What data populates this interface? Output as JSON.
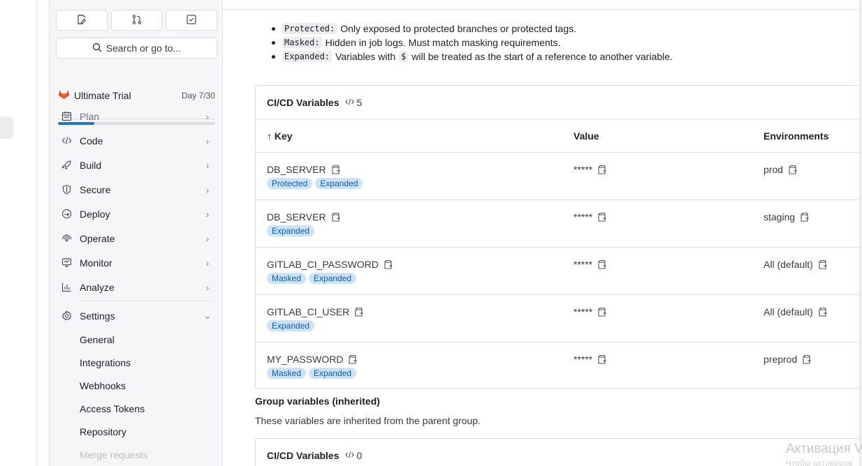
{
  "sidebar": {
    "search_label": "Search or go to...",
    "trial": {
      "label": "Ultimate Trial",
      "day": "Day 7/30",
      "progress": 0.233
    },
    "nav": [
      {
        "label": "Plan",
        "icon": "plan-icon"
      },
      {
        "label": "Code",
        "icon": "code-icon"
      },
      {
        "label": "Build",
        "icon": "rocket-icon"
      },
      {
        "label": "Secure",
        "icon": "shield-icon"
      },
      {
        "label": "Deploy",
        "icon": "deploy-icon"
      },
      {
        "label": "Operate",
        "icon": "cloud-icon"
      },
      {
        "label": "Monitor",
        "icon": "monitor-icon"
      },
      {
        "label": "Analyze",
        "icon": "chart-icon"
      }
    ],
    "settings": {
      "label": "Settings",
      "items": [
        "General",
        "Integrations",
        "Webhooks",
        "Access Tokens",
        "Repository",
        "Merge requests"
      ]
    }
  },
  "info": {
    "protected_code": "Protected:",
    "protected_text": "Only exposed to protected branches or protected tags.",
    "masked_code": "Masked:",
    "masked_text": "Hidden in job logs. Must match masking requirements.",
    "expanded_code": "Expanded:",
    "expanded_text_1": "Variables with",
    "expanded_symbol": "$",
    "expanded_text_2": "will be treated as the start of a reference to another variable."
  },
  "variables_card": {
    "title": "CI/CD Variables",
    "count": "5",
    "headers": {
      "key": "Key",
      "value": "Value",
      "environments": "Environments"
    },
    "sort_indicator": "↑",
    "rows": [
      {
        "key": "DB_SERVER",
        "value": "*****",
        "env": "prod",
        "badges": [
          "Protected",
          "Expanded"
        ]
      },
      {
        "key": "DB_SERVER",
        "value": "*****",
        "env": "staging",
        "badges": [
          "Expanded"
        ]
      },
      {
        "key": "GITLAB_CI_PASSWORD",
        "value": "*****",
        "env": "All (default)",
        "badges": [
          "Masked",
          "Expanded"
        ]
      },
      {
        "key": "GITLAB_CI_USER",
        "value": "*****",
        "env": "All (default)",
        "badges": [
          "Expanded"
        ]
      },
      {
        "key": "MY_PASSWORD",
        "value": "*****",
        "env": "preprod",
        "badges": [
          "Masked",
          "Expanded"
        ]
      }
    ]
  },
  "group_section": {
    "title": "Group variables (inherited)",
    "description": "These variables are inherited from the parent group.",
    "card_title": "CI/CD Variables",
    "card_count": "0"
  },
  "watermark": {
    "line1": "Активация V",
    "line2": "Чтобы активиров"
  },
  "colors": {
    "badge_bg": "#cbe2f9",
    "badge_text": "#0b5cad",
    "trial_fill": "#1f75cb",
    "tanuki": "#e24329"
  }
}
